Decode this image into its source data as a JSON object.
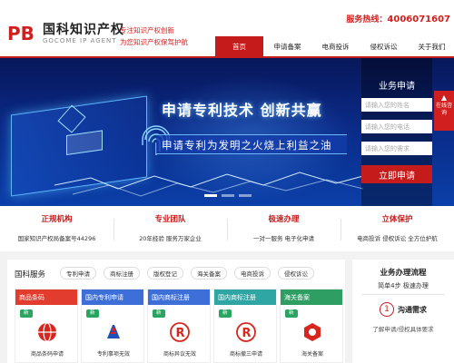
{
  "brand": {
    "logo_letters": "PB",
    "name": "国科知识产权",
    "english": "GOCOME IP AGENT",
    "slogan_line1": "专注知识产权创新",
    "slogan_line2": "为您知识产权保驾护航"
  },
  "hotline": {
    "label": "服务热线：",
    "number": "4006071607"
  },
  "nav": [
    {
      "label": "首页",
      "active": true
    },
    {
      "label": "申请备案"
    },
    {
      "label": "电商投诉"
    },
    {
      "label": "侵权诉讼"
    },
    {
      "label": "关于我们"
    }
  ],
  "banner": {
    "headline": "申请专利技术  创新共赢",
    "subline": "申请专利为发明之火烧上利益之油"
  },
  "apply_form": {
    "title": "业务申请",
    "name_placeholder": "请输入您的姓名",
    "phone_placeholder": "请输入您的电话",
    "need_placeholder": "请输入您的需求",
    "submit_label": "立即申请"
  },
  "side_float": {
    "label": "在线咨询"
  },
  "features": [
    {
      "title": "正规机构",
      "desc": "国家知识产权局备案号44296"
    },
    {
      "title": "专业团队",
      "desc": "20年经验 服务万家企业"
    },
    {
      "title": "极速办理",
      "desc": "一对一服务 电子化申请"
    },
    {
      "title": "立体保护",
      "desc": "电商投诉 侵权诉讼 全方位护航"
    }
  ],
  "services": {
    "title": "国科服务",
    "tabs": [
      "专利申请",
      "商标注册",
      "版权登记",
      "海关备案",
      "电商投诉",
      "侵权诉讼"
    ],
    "cards": [
      {
        "head": "商品条码",
        "tag": "新",
        "name": "商品条码申请",
        "color": "#e23c2e",
        "icon": "globe-icon"
      },
      {
        "head": "国内专利申请",
        "tag": "新",
        "name": "专利事项无效",
        "color": "#3e6fd8",
        "icon": "patent-icon"
      },
      {
        "head": "国内商标注册",
        "tag": "新",
        "name": "商标异议无效",
        "color": "#3e6fd8",
        "icon": "trademark-icon"
      },
      {
        "head": "国内商标注册",
        "tag": "新",
        "name": "商标撤三申请",
        "color": "#2fa6a3",
        "icon": "trademark-icon"
      },
      {
        "head": "海关备案",
        "tag": "新",
        "name": "海关备案",
        "color": "#2e9e62",
        "icon": "customs-icon"
      }
    ]
  },
  "process": {
    "title": "业务办理流程",
    "subtitle": "简单4步 极速办理",
    "step_number": "1",
    "step_name": "沟通需求",
    "step_desc": "了解申请/侵权具体要求"
  }
}
